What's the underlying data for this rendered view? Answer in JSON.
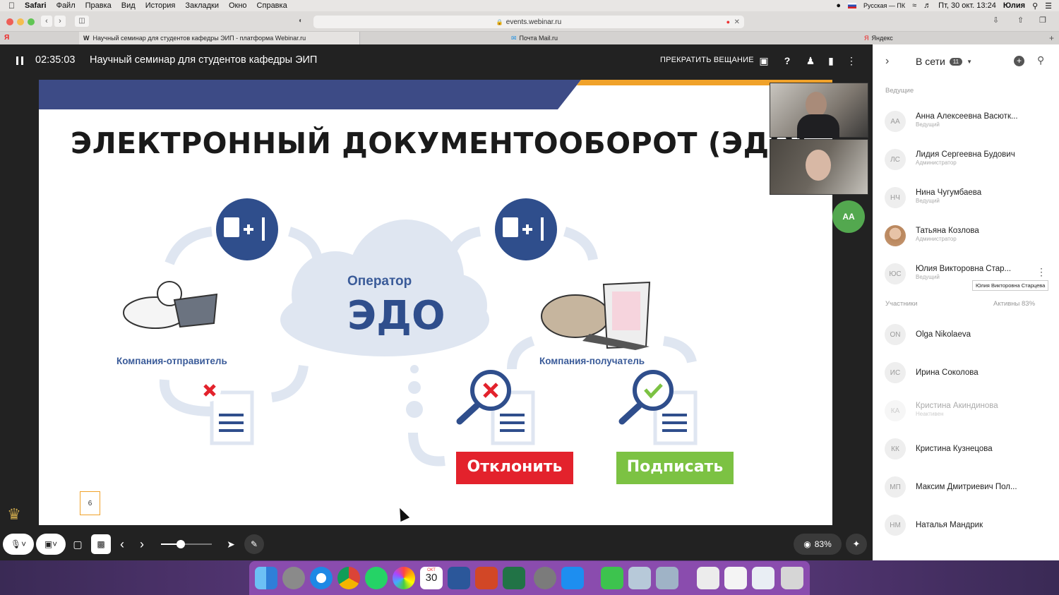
{
  "menubar": {
    "app": "Safari",
    "items": [
      "Файл",
      "Правка",
      "Вид",
      "История",
      "Закладки",
      "Окно",
      "Справка"
    ],
    "keyboard": "Русская — ПК",
    "datetime": "Пт, 30 окт. 13:24",
    "user": "Юлия"
  },
  "browser": {
    "url": "events.webinar.ru",
    "tabs": [
      "Научный семинар для студентов кафедры ЭИП - платформа Webinar.ru",
      "Почта Mail.ru",
      "Яндекс"
    ]
  },
  "webinar": {
    "timer": "02:35:03",
    "title": "Научный семинар для студентов кафедры ЭИП",
    "stop_label": "ПРЕКРАТИТЬ ВЕЩАНИЕ",
    "speaker_badge": "АА",
    "zoom_pct": "83%"
  },
  "slide": {
    "title": "ЭЛЕКТРОННЫЙ ДОКУМЕНТООБОРОТ (ЭДО)",
    "operator_label": "Оператор",
    "edo_label": "ЭДО",
    "sender_label": "Компания-отправитель",
    "receiver_label": "Компания-получатель",
    "reject_label": "Отклонить",
    "sign_label": "Подписать",
    "page_number": "6"
  },
  "panel": {
    "online_label": "В сети",
    "online_count": "11",
    "hosts_header": "Ведущие",
    "participants_header": "Участники",
    "active_label": "Активны 83%",
    "tooltip": "Юлия Викторовна Старцева",
    "hosts": [
      {
        "initials": "АА",
        "name": "Анна Алексеевна Васютк...",
        "role": "Ведущий"
      },
      {
        "initials": "ЛС",
        "name": "Лидия Сергеевна Будович",
        "role": "Администратор"
      },
      {
        "initials": "НЧ",
        "name": "Нина Чугумбаева",
        "role": "Ведущий"
      },
      {
        "initials": "",
        "name": "Татьяна Козлова",
        "role": "Администратор"
      },
      {
        "initials": "ЮС",
        "name": "Юлия Викторовна Стар...",
        "role": "Ведущий"
      }
    ],
    "participants": [
      {
        "initials": "ON",
        "name": "Olga Nikolaeva",
        "role": ""
      },
      {
        "initials": "ИС",
        "name": "Ирина Соколова",
        "role": ""
      },
      {
        "initials": "КА",
        "name": "Кристина Акиндинова",
        "role": "Неактивен"
      },
      {
        "initials": "КК",
        "name": "Кристина Кузнецова",
        "role": ""
      },
      {
        "initials": "МП",
        "name": "Максим Дмитриевич Пол...",
        "role": ""
      },
      {
        "initials": "НМ",
        "name": "Наталья Мандрик",
        "role": ""
      }
    ]
  },
  "dock": {
    "calendar_month": "ОКТ",
    "calendar_day": "30"
  }
}
